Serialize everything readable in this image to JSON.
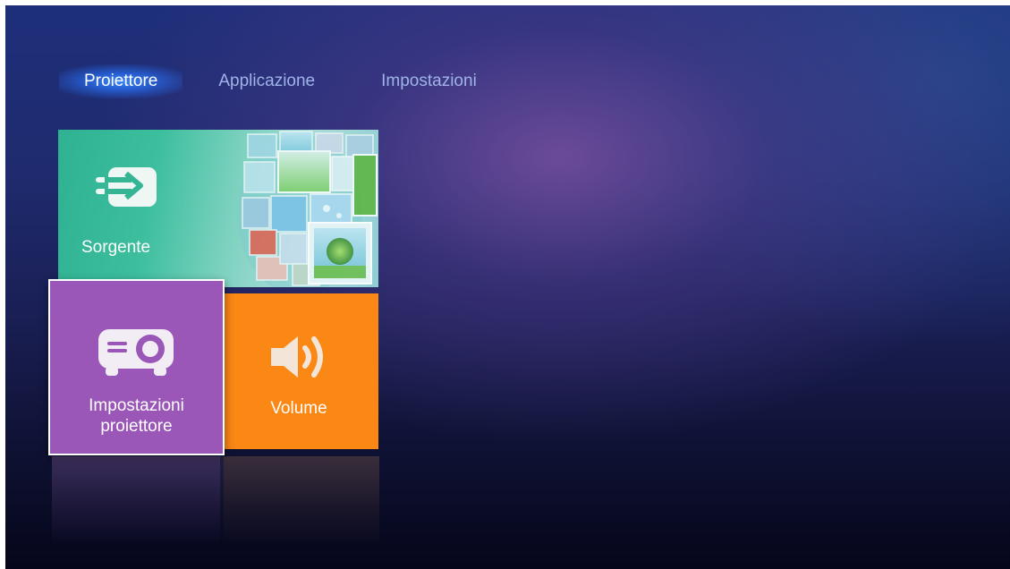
{
  "tabs": [
    {
      "label": "Proiettore",
      "active": true
    },
    {
      "label": "Applicazione",
      "active": false
    },
    {
      "label": "Impostazioni",
      "active": false
    }
  ],
  "tiles": {
    "source": {
      "label": "Sorgente",
      "icon": "source-input-icon",
      "color": "#33b595"
    },
    "projector": {
      "label_line1": "Impostazioni",
      "label_line2": "proiettore",
      "icon": "projector-icon",
      "color": "#9a57b8",
      "selected": true
    },
    "volume": {
      "label": "Volume",
      "icon": "speaker-icon",
      "color": "#fb8715"
    }
  },
  "colors": {
    "active_tab_glow": "#2f7af5",
    "inactive_tab_text": "#9fb4e6"
  }
}
